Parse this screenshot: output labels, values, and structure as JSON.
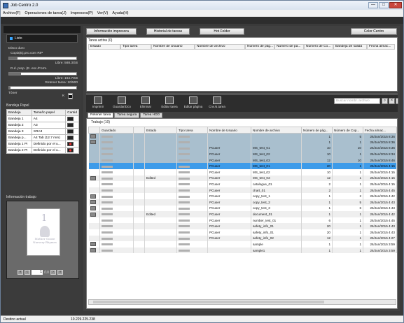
{
  "window": {
    "title": "Job Centro 2.0",
    "min": "—",
    "max": "□",
    "close": "✕"
  },
  "menu": [
    "Archivo(F)",
    "Operaciones de tarea(J)",
    "Impresora(P)",
    "Ver(V)",
    "Ayuda(H)"
  ],
  "device": {
    "status": "Listo",
    "disk_label": "Disco duro",
    "copy_label": "Copia(Ej.pro.com RIP",
    "copy_free": "Libre: 588.3GB",
    "dprep_label": "D.d. prep. (E. esc./Form.",
    "dprep_free": "Libre: 164.7GB",
    "retain_free": "Retener tarea: 10/500",
    "toner_label": "Tóner",
    "toner_code": "K",
    "copy_fill": 0.12,
    "dprep_fill": 0.18,
    "retain_fill": 0.02
  },
  "trays": {
    "header": "Bandeja Papel",
    "columns": [
      "Bandeja",
      "Tamaño papel",
      "Cantid"
    ],
    "rows": [
      [
        "Bandeja 1",
        "A4"
      ],
      [
        "Bandeja 2",
        "A3"
      ],
      [
        "Bandeja 3",
        "SRA3"
      ],
      [
        "Bandeja p...",
        "A4 Tab (12.7 mm)"
      ],
      [
        "Bandeja 1 PI",
        "Definido por el u..."
      ],
      [
        "Bandeja 2 PI",
        "Definido por el u..."
      ]
    ]
  },
  "preview": {
    "header": "Información trabajo",
    "page_num": "1",
    "page_text": "Mother Goose Nursery Rhymes",
    "page_field": "1",
    "page_total": "/10"
  },
  "top_buttons": [
    "Información impresora",
    "Historial de tareas",
    "Hot Folder",
    "Color Centro"
  ],
  "active": {
    "title": "Tarea activa (0)",
    "columns": [
      "Estado",
      "Tipo tarea",
      "Nombre de Usuario",
      "Nombre de archivo",
      "Número de pág...",
      "Número de pá...",
      "Número de Co...",
      "Bandeja de salida",
      "Fecha almac..."
    ]
  },
  "toolbar": [
    "Imprimir",
    "Guardar/Dco",
    "Eliminar",
    "Editar tarea",
    "Editar página",
    "Cnv.N.tarea"
  ],
  "search_placeholder": "Buscar nombr. archivo",
  "tabs": [
    "Retener tarea",
    "Tarea segura",
    "Tarea HDD"
  ],
  "jobs": {
    "title": "Trabajo (10)",
    "columns": [
      "",
      "Guardado",
      "",
      "Estado",
      "Tipo tarea",
      "Nombre de Usuario",
      "Nombre de archivo",
      "Número de pág...",
      "Número de Cop...",
      "Fecha almac..."
    ],
    "rows": [
      {
        "icon": true,
        "estado": "",
        "user": "",
        "file": "",
        "pages": "1",
        "copies": "5",
        "date": "26/Jun/2015 8:36",
        "style": "hold"
      },
      {
        "icon": true,
        "estado": "",
        "user": "",
        "file": "",
        "pages": "1",
        "copies": "1",
        "date": "26/Jun/2015 8:36",
        "style": "hold"
      },
      {
        "icon": false,
        "estado": "",
        "user": "PCuser",
        "file": "MS_test_01",
        "pages": "10",
        "copies": "10",
        "date": "26/Jun/2015 8:36",
        "style": "hold"
      },
      {
        "icon": false,
        "estado": "",
        "user": "PCuser",
        "file": "MS_test_02",
        "pages": "10",
        "copies": "1",
        "date": "26/Jun/2015 8:34",
        "style": "hold"
      },
      {
        "icon": false,
        "estado": "",
        "user": "PCuser",
        "file": "MS_test_03",
        "pages": "12",
        "copies": "10",
        "date": "26/Jun/2015 8:46",
        "style": "hold"
      },
      {
        "icon": false,
        "estado": "",
        "user": "PCuser",
        "file": "MS_test_01",
        "pages": "20",
        "copies": "1",
        "date": "26/Jun/2015 4:15",
        "style": "sel"
      },
      {
        "icon": false,
        "estado": "",
        "user": "PCuser",
        "file": "MS_test_02",
        "pages": "10",
        "copies": "1",
        "date": "26/Jun/2015 4:15",
        "style": ""
      },
      {
        "icon": true,
        "estado": "Edited",
        "user": "PCuser",
        "file": "MS_test_03",
        "pages": "12",
        "copies": "1",
        "date": "26/Jun/2015 4:15",
        "style": "alt"
      },
      {
        "icon": false,
        "estado": "",
        "user": "PCuser",
        "file": "catalogue_01",
        "pages": "2",
        "copies": "1",
        "date": "26/Jun/2015 4:15",
        "style": ""
      },
      {
        "icon": false,
        "estado": "",
        "user": "PCuser",
        "file": "chart_01",
        "pages": "2",
        "copies": "1",
        "date": "26/Jun/2015 4:45",
        "style": "alt"
      },
      {
        "icon": true,
        "estado": "",
        "user": "PCuser",
        "file": "copy_test_1",
        "pages": "1",
        "copies": "2",
        "date": "26/Jun/2015 4:42",
        "style": ""
      },
      {
        "icon": true,
        "estado": "",
        "user": "PCuser",
        "file": "copy_test_2",
        "pages": "1",
        "copies": "5",
        "date": "26/Jun/2015 4:43",
        "style": "alt"
      },
      {
        "icon": true,
        "estado": "",
        "user": "PCuser",
        "file": "copy_test_3",
        "pages": "1",
        "copies": "6",
        "date": "26/Jun/2015 4:43",
        "style": ""
      },
      {
        "icon": true,
        "estado": "Edited",
        "user": "PCuser",
        "file": "document_01",
        "pages": "1",
        "copies": "1",
        "date": "26/Jun/2015 4:42",
        "style": "alt"
      },
      {
        "icon": false,
        "estado": "",
        "user": "PCuser",
        "file": "number_test_01",
        "pages": "6",
        "copies": "1",
        "date": "26/Jun/2015 4:45",
        "style": ""
      },
      {
        "icon": false,
        "estado": "",
        "user": "PCuser",
        "file": "safety_info_01",
        "pages": "20",
        "copies": "1",
        "date": "26/Jun/2015 4:43",
        "style": "alt"
      },
      {
        "icon": false,
        "estado": "",
        "user": "PCuser",
        "file": "safety_info_01",
        "pages": "20",
        "copies": "1",
        "date": "26/Jun/2015 4:43",
        "style": ""
      },
      {
        "icon": false,
        "estado": "",
        "user": "PCuser",
        "file": "safety_info_02",
        "pages": "12",
        "copies": "1",
        "date": "26/Jun/2015 4:27",
        "style": "alt"
      },
      {
        "icon": true,
        "estado": "",
        "user": "",
        "file": "sample",
        "pages": "1",
        "copies": "1",
        "date": "26/Jun/2015 3:59",
        "style": ""
      },
      {
        "icon": true,
        "estado": "",
        "user": "",
        "file": "sample1",
        "pages": "1",
        "copies": "1",
        "date": "26/Jun/2015 3:59",
        "style": "alt"
      }
    ]
  },
  "status": {
    "label": "Destino actual",
    "value": "10.229.225.238"
  }
}
